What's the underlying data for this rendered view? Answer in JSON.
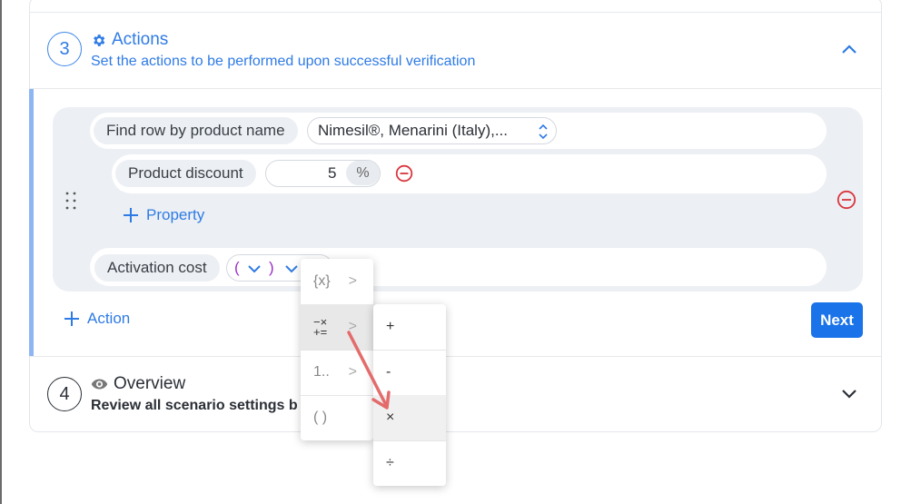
{
  "step3": {
    "number": "3",
    "title": "Actions",
    "subtitle": "Set the actions to be performed upon successful verification",
    "title_icon": "gear-icon",
    "toggle_icon": "chevron-up-icon"
  },
  "action": {
    "find_row_label": "Find row by product name",
    "find_row_value": "Nimesil®, Menarini (Italy),...",
    "property_label": "Product discount",
    "property_value": "5",
    "property_unit": "%",
    "add_property_label": "Property",
    "activation_label": "Activation cost",
    "paren_open": "(",
    "paren_close": ")"
  },
  "add_action_label": "Action",
  "next_label": "Next",
  "step4": {
    "number": "4",
    "title": "Overview",
    "subtitle": "Review all scenario settings b",
    "title_icon": "eye-icon",
    "toggle_icon": "chevron-down-icon"
  },
  "menu": {
    "items": [
      {
        "label": "{x}",
        "arrow": ">"
      },
      {
        "label": "−×\n+=",
        "arrow": ">"
      },
      {
        "label": "1..",
        "arrow": ">"
      },
      {
        "label": "( )",
        "arrow": ""
      }
    ]
  },
  "submenu": {
    "items": [
      "+",
      "-",
      "×",
      "÷"
    ]
  },
  "colors": {
    "accent": "#2f7be5",
    "remove": "#d9363e",
    "paren": "#9b2fc9",
    "annotation_arrow": "#e46b6b"
  }
}
